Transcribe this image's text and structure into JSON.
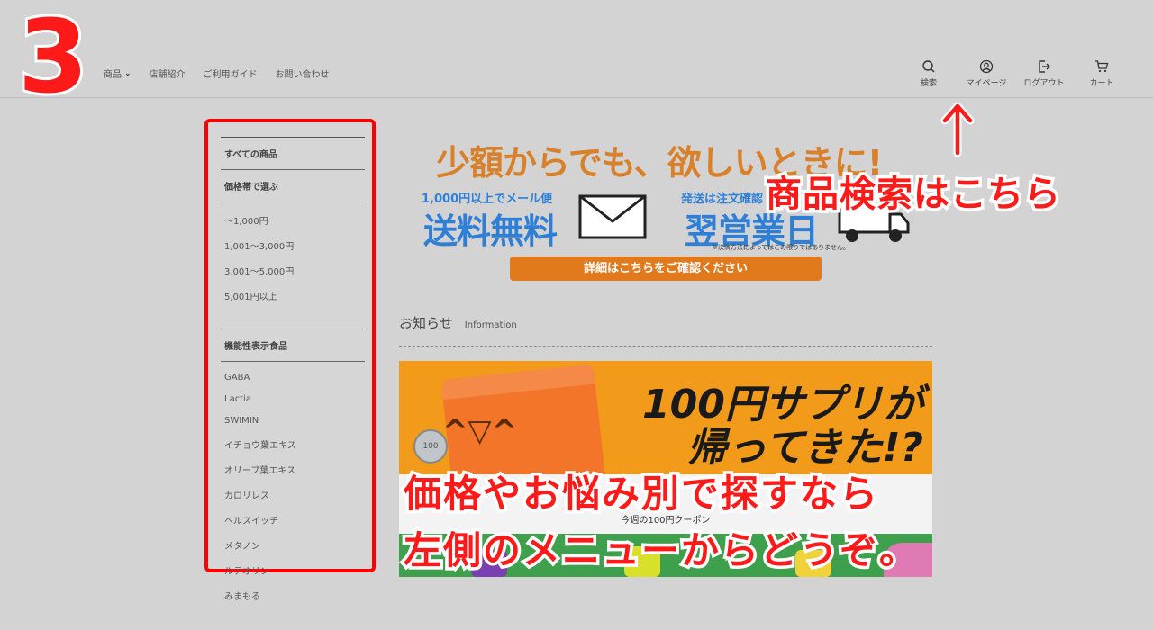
{
  "step_number": "3",
  "nav": {
    "items": [
      "商品",
      "店舗紹介",
      "ご利用ガイド",
      "お問い合わせ"
    ]
  },
  "utility": {
    "search": "検索",
    "mypage": "マイページ",
    "logout": "ログアウト",
    "cart": "カート"
  },
  "sidebar": {
    "all_products": "すべての商品",
    "price_heading": "価格帯で選ぶ",
    "price_ranges": [
      "〜1,000円",
      "1,001〜3,000円",
      "3,001〜5,000円",
      "5,001円以上"
    ],
    "functional_heading": "機能性表示食品",
    "functional_items": [
      "GABA",
      "Lactia",
      "SWIMIN",
      "イチョウ葉エキス",
      "オリーブ葉エキス",
      "カロリレス",
      "ヘルスイッチ",
      "メタノン",
      "ルテオリン",
      "みまもる"
    ]
  },
  "banner": {
    "title": "少額からでも、欲しいときに!",
    "shipping_sub": "1,000円以上でメール便",
    "shipping_main": "送料無料",
    "dispatch_sub": "発送は注文確認",
    "dispatch_main": "翌営業日",
    "note": "※決済方法によってはこの限りではありません。",
    "button": "詳細はこちらをご確認ください"
  },
  "info": {
    "title_jp": "お知らせ",
    "title_en": "Information"
  },
  "promo": {
    "headline1": "100円サプリが",
    "headline2": "帰ってきた!?",
    "coin": "100",
    "coupon": "今週の100円クーポン"
  },
  "callouts": {
    "search_hint": "商品検索はこちら",
    "menu_hint_line1": "価格やお悩み別で探すなら",
    "menu_hint_line2": "左側のメニューからどうぞ。"
  },
  "colors": {
    "highlight_red": "#ff0000",
    "banner_orange": "#d9802a",
    "banner_blue": "#2f7fd6",
    "button_orange": "#e07a1c"
  }
}
